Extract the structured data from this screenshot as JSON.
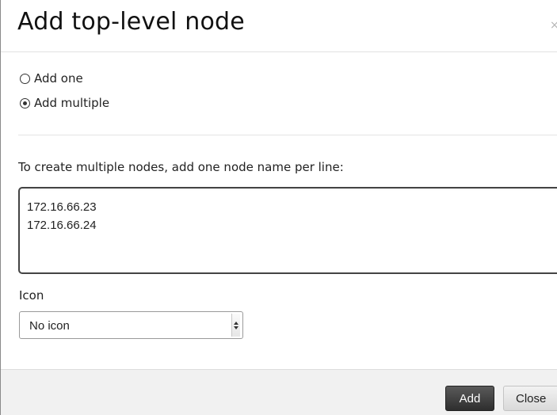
{
  "dialog": {
    "title": "Add top-level node",
    "close_glyph": "×"
  },
  "mode": {
    "options": [
      {
        "label": "Add one",
        "checked": false
      },
      {
        "label": "Add multiple",
        "checked": true
      }
    ]
  },
  "nodes": {
    "instructions": "To create multiple nodes, add one node name per line:",
    "lines": [
      "172.16.66.23",
      "172.16.66.24"
    ]
  },
  "icon": {
    "label": "Icon",
    "selected": "No icon"
  },
  "footer": {
    "add_label": "Add",
    "close_label": "Close"
  },
  "icons": {
    "close": "close-icon",
    "select_arrows": "updown-arrows-icon"
  },
  "colors": {
    "primary_button": "#3a3a3a",
    "footer_bg": "#f1f1f1"
  }
}
